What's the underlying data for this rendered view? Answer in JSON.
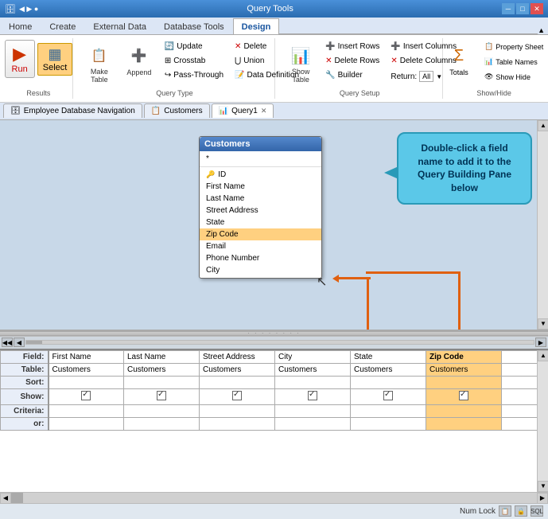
{
  "titlebar": {
    "left_icons": "◀ ▶ ●",
    "query_tools_label": "Query Tools",
    "minimize": "─",
    "maximize": "□",
    "close": "✕"
  },
  "ribbon": {
    "tabs": [
      "Home",
      "Create",
      "External Data",
      "Database Tools",
      "Design"
    ],
    "active_tab": "Design",
    "groups": {
      "results": {
        "label": "Results",
        "run_label": "Run",
        "select_label": "Select"
      },
      "query_type": {
        "label": "Query Type",
        "make_table": "Make Table",
        "append": "Append",
        "update": "Update",
        "crosstab": "Crosstab",
        "pass_through": "Pass-Through",
        "delete": "Delete",
        "union": "Union",
        "data_definition": "Data Definition"
      },
      "query_setup": {
        "label": "Query Setup",
        "show_table": "Show Table",
        "insert_rows": "Insert Rows",
        "delete_rows": "Delete Rows",
        "builder": "Builder",
        "insert_columns": "Insert Columns",
        "delete_columns": "Delete Columns",
        "return_label": "Return:",
        "return_value": "All"
      },
      "show_hide": {
        "label": "Show/Hide",
        "totals": "Totals",
        "show_hide_btn": "Show Hide"
      }
    }
  },
  "nav_tabs": [
    {
      "label": "Employee Database Navigation",
      "icon": "🗄",
      "active": false,
      "closable": false
    },
    {
      "label": "Customers",
      "icon": "📋",
      "active": false,
      "closable": false
    },
    {
      "label": "Query1",
      "icon": "📊",
      "active": true,
      "closable": true
    }
  ],
  "table_box": {
    "title": "Customers",
    "fields": [
      {
        "name": "*",
        "pk": false
      },
      {
        "name": "ID",
        "pk": true
      },
      {
        "name": "First Name",
        "pk": false
      },
      {
        "name": "Last Name",
        "pk": false
      },
      {
        "name": "Street Address",
        "pk": false
      },
      {
        "name": "State",
        "pk": false
      },
      {
        "name": "Zip Code",
        "pk": false,
        "selected": true
      },
      {
        "name": "Email",
        "pk": false
      },
      {
        "name": "Phone Number",
        "pk": false
      },
      {
        "name": "City",
        "pk": false
      }
    ]
  },
  "tooltip": {
    "text": "Double-click a field name to add it to the Query Building Pane below"
  },
  "query_grid": {
    "row_headers": [
      "Field:",
      "Table:",
      "Sort:",
      "Show:",
      "Criteria:",
      "or:"
    ],
    "columns": [
      {
        "field": "First Name",
        "table": "Customers",
        "sort": "",
        "show": true,
        "criteria": "",
        "or": "",
        "highlight": false
      },
      {
        "field": "Last Name",
        "table": "Customers",
        "sort": "",
        "show": true,
        "criteria": "",
        "or": "",
        "highlight": false
      },
      {
        "field": "Street Address",
        "table": "Customers",
        "sort": "",
        "show": true,
        "criteria": "",
        "or": "",
        "highlight": false
      },
      {
        "field": "City",
        "table": "Customers",
        "sort": "",
        "show": true,
        "criteria": "",
        "or": "",
        "highlight": false
      },
      {
        "field": "State",
        "table": "Customers",
        "sort": "",
        "show": true,
        "criteria": "",
        "or": "",
        "highlight": false
      },
      {
        "field": "Zip Code",
        "table": "Customers",
        "sort": "",
        "show": true,
        "criteria": "",
        "or": "",
        "highlight": true
      }
    ]
  },
  "status": {
    "num_lock": "Num Lock"
  }
}
